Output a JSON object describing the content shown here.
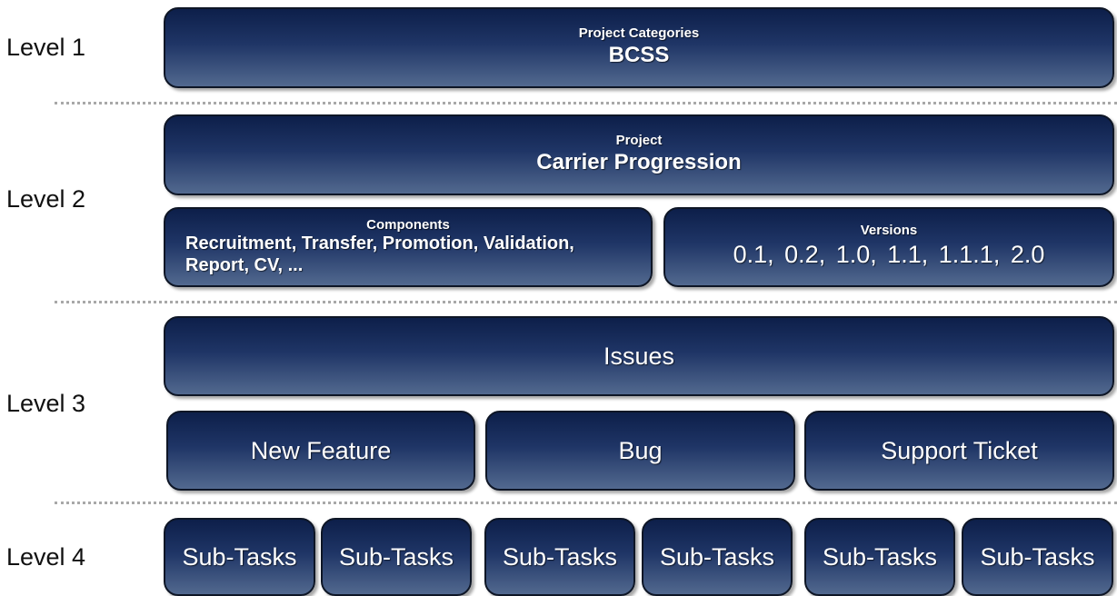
{
  "levels": {
    "l1": "Level 1",
    "l2": "Level 2",
    "l3": "Level 3",
    "l4": "Level 4"
  },
  "level1": {
    "category_label": "Project Categories",
    "category_name": "BCSS"
  },
  "level2": {
    "project_label": "Project",
    "project_name": "Carrier Progression",
    "components_label": "Components",
    "components_text": "Recruitment, Transfer, Promotion, Validation, Report, CV, ...",
    "versions_label": "Versions",
    "versions_text": "0.1,  0.2,  1.0,  1.1,  1.1.1,  2.0"
  },
  "level3": {
    "issues_label": "Issues",
    "issue_types": [
      "New Feature",
      "Bug",
      "Support Ticket"
    ]
  },
  "level4": {
    "subtasks": [
      "Sub-Tasks",
      "Sub-Tasks",
      "Sub-Tasks",
      "Sub-Tasks",
      "Sub-Tasks",
      "Sub-Tasks"
    ]
  },
  "colors": {
    "box_top": "#0d1f4a",
    "box_bottom": "#52698f",
    "box_border": "#0e1626",
    "divider": "#a8a8a8"
  }
}
